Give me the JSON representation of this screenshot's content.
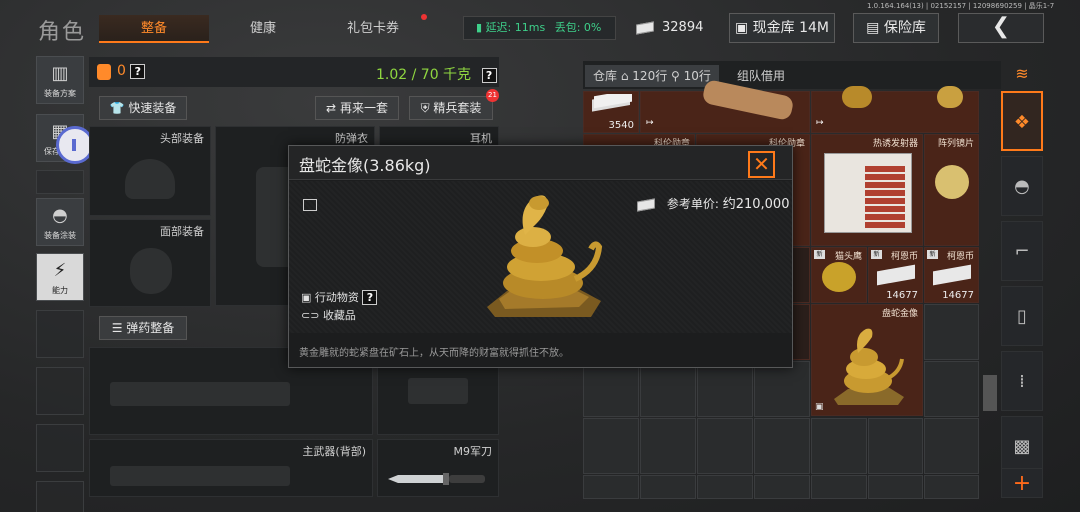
{
  "header": {
    "title": "角色",
    "tabs": [
      {
        "label": "整备",
        "active": true
      },
      {
        "label": "健康",
        "active": false
      },
      {
        "label": "礼包卡券",
        "active": false
      }
    ],
    "latency": "延迟: 11ms",
    "packet_loss": "丢包: 0%",
    "currency_amount": "32894",
    "cash_vault": "现金库 14M",
    "safe_box": "保险库",
    "back_symbol": "❮",
    "version": "1.0.164.164(13) | 02152157 | 120986902​59 | 晶乐1-7"
  },
  "sidebar": {
    "items": [
      {
        "label": "装备方案",
        "icon": "vest-icon"
      },
      {
        "label": "保存方案",
        "icon": "save-icon"
      },
      {
        "label": "装备涂装",
        "icon": "helmet-icon"
      },
      {
        "label": "能力",
        "icon": "ability-icon"
      }
    ]
  },
  "equipment": {
    "count": "0",
    "weight": "1.02 / 70 千克",
    "help": "?",
    "quick_equip": "快速装备",
    "again_set": "再来一套",
    "elite_set": "精兵套装",
    "elite_badge": "21",
    "slots": {
      "head": "头部装备",
      "armor": "防弹衣",
      "earphone": "耳机",
      "face": "面部装备",
      "ammo": "弹药整备",
      "main_weapon": "主武器(背部)",
      "knife": "M9军刀"
    }
  },
  "warehouse": {
    "tab_storage": "仓库",
    "rows_label": "120行",
    "rows2_label": "10行",
    "team_borrow": "组队借用",
    "cells": [
      {
        "label": "",
        "num": "3540"
      },
      {
        "label": "科伦勋章",
        "num": ""
      },
      {
        "label": "科伦勋章",
        "num": ""
      },
      {
        "label": "热诱发射器",
        "num": ""
      },
      {
        "label": "阵列镜片",
        "num": ""
      },
      {
        "label": "猫头鹰",
        "num": ""
      },
      {
        "label": "柯恩币",
        "num": "14677"
      },
      {
        "label": "柯恩币",
        "num": "14677"
      },
      {
        "label": "盘蛇金像",
        "num": ""
      }
    ]
  },
  "modal": {
    "title": "盘蛇金像(3.86kg)",
    "close": "✕",
    "ref_price_label": "参考单价:",
    "ref_price_value": "约210,000",
    "tag1": "行动物资",
    "tag2": "收藏品",
    "description": "黄金雕就的蛇紧盘在矿石上，从天而降的财富就得抓住不放。"
  },
  "colors": {
    "accent": "#ff7a1a",
    "weight_green": "#8fd640",
    "ping_green": "#3ed08a",
    "cell_red": "#4a2418"
  }
}
